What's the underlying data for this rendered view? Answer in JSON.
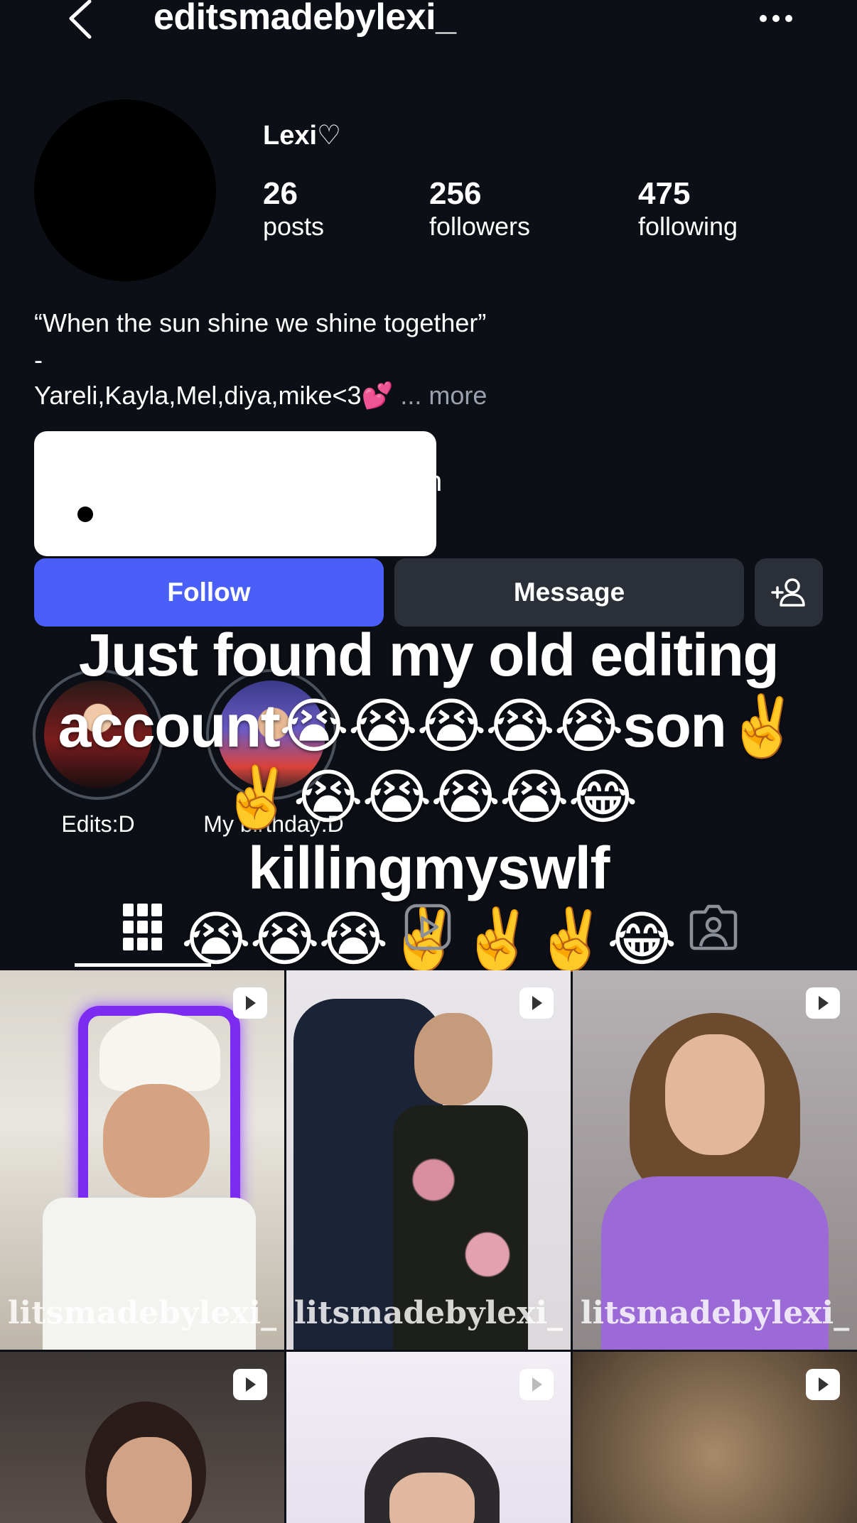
{
  "header": {
    "username": "editsmadebylexi_",
    "back_icon": "chevron-left-icon",
    "menu_icon": "more-horizontal-icon"
  },
  "profile": {
    "display_name": "Lexi♡",
    "stats": [
      {
        "value": "26",
        "label": "posts"
      },
      {
        "value": "256",
        "label": "followers"
      },
      {
        "value": "475",
        "label": "following"
      }
    ],
    "bio_line1": "“When the sun shine we shine together”",
    "bio_line2": "-",
    "bio_line3": "Yareli,Kayla,Mel,diya,mike<3💕",
    "bio_ellipsis": "...",
    "bio_more": "more",
    "link_tail": "n"
  },
  "actions": {
    "follow": "Follow",
    "message": "Message",
    "add_icon": "add-person-icon"
  },
  "highlights": [
    {
      "label": "Edits:D"
    },
    {
      "label": "My birthday:D"
    }
  ],
  "overlay": {
    "line1": "Just found my old editing",
    "line2": "account😭😭😭😭😭son✌️",
    "line3": "✌️😭😭😭😭😂killingmyswlf",
    "line4": "😭😭😭✌️✌️✌️😂"
  },
  "tabs": [
    {
      "name": "posts-grid",
      "icon": "grid-icon",
      "active": true
    },
    {
      "name": "reels",
      "icon": "reels-icon",
      "active": false
    },
    {
      "name": "tagged",
      "icon": "tagged-person-icon",
      "active": false
    }
  ],
  "grid": {
    "watermark": "editsmadebylexi_",
    "tiles": [
      {
        "watermark_visible": "litsmadebylexi_"
      },
      {
        "watermark_visible": "litsmadebylexi_"
      },
      {
        "watermark_visible": "litsmadebylexi_"
      },
      {
        "watermark_visible": ""
      },
      {
        "watermark_visible": ""
      },
      {
        "watermark_visible": ""
      }
    ]
  },
  "colors": {
    "background": "#0c0f16",
    "follow": "#4a5ff7",
    "secondary_button": "#2b2f37",
    "muted_text": "#9aa1ad"
  }
}
